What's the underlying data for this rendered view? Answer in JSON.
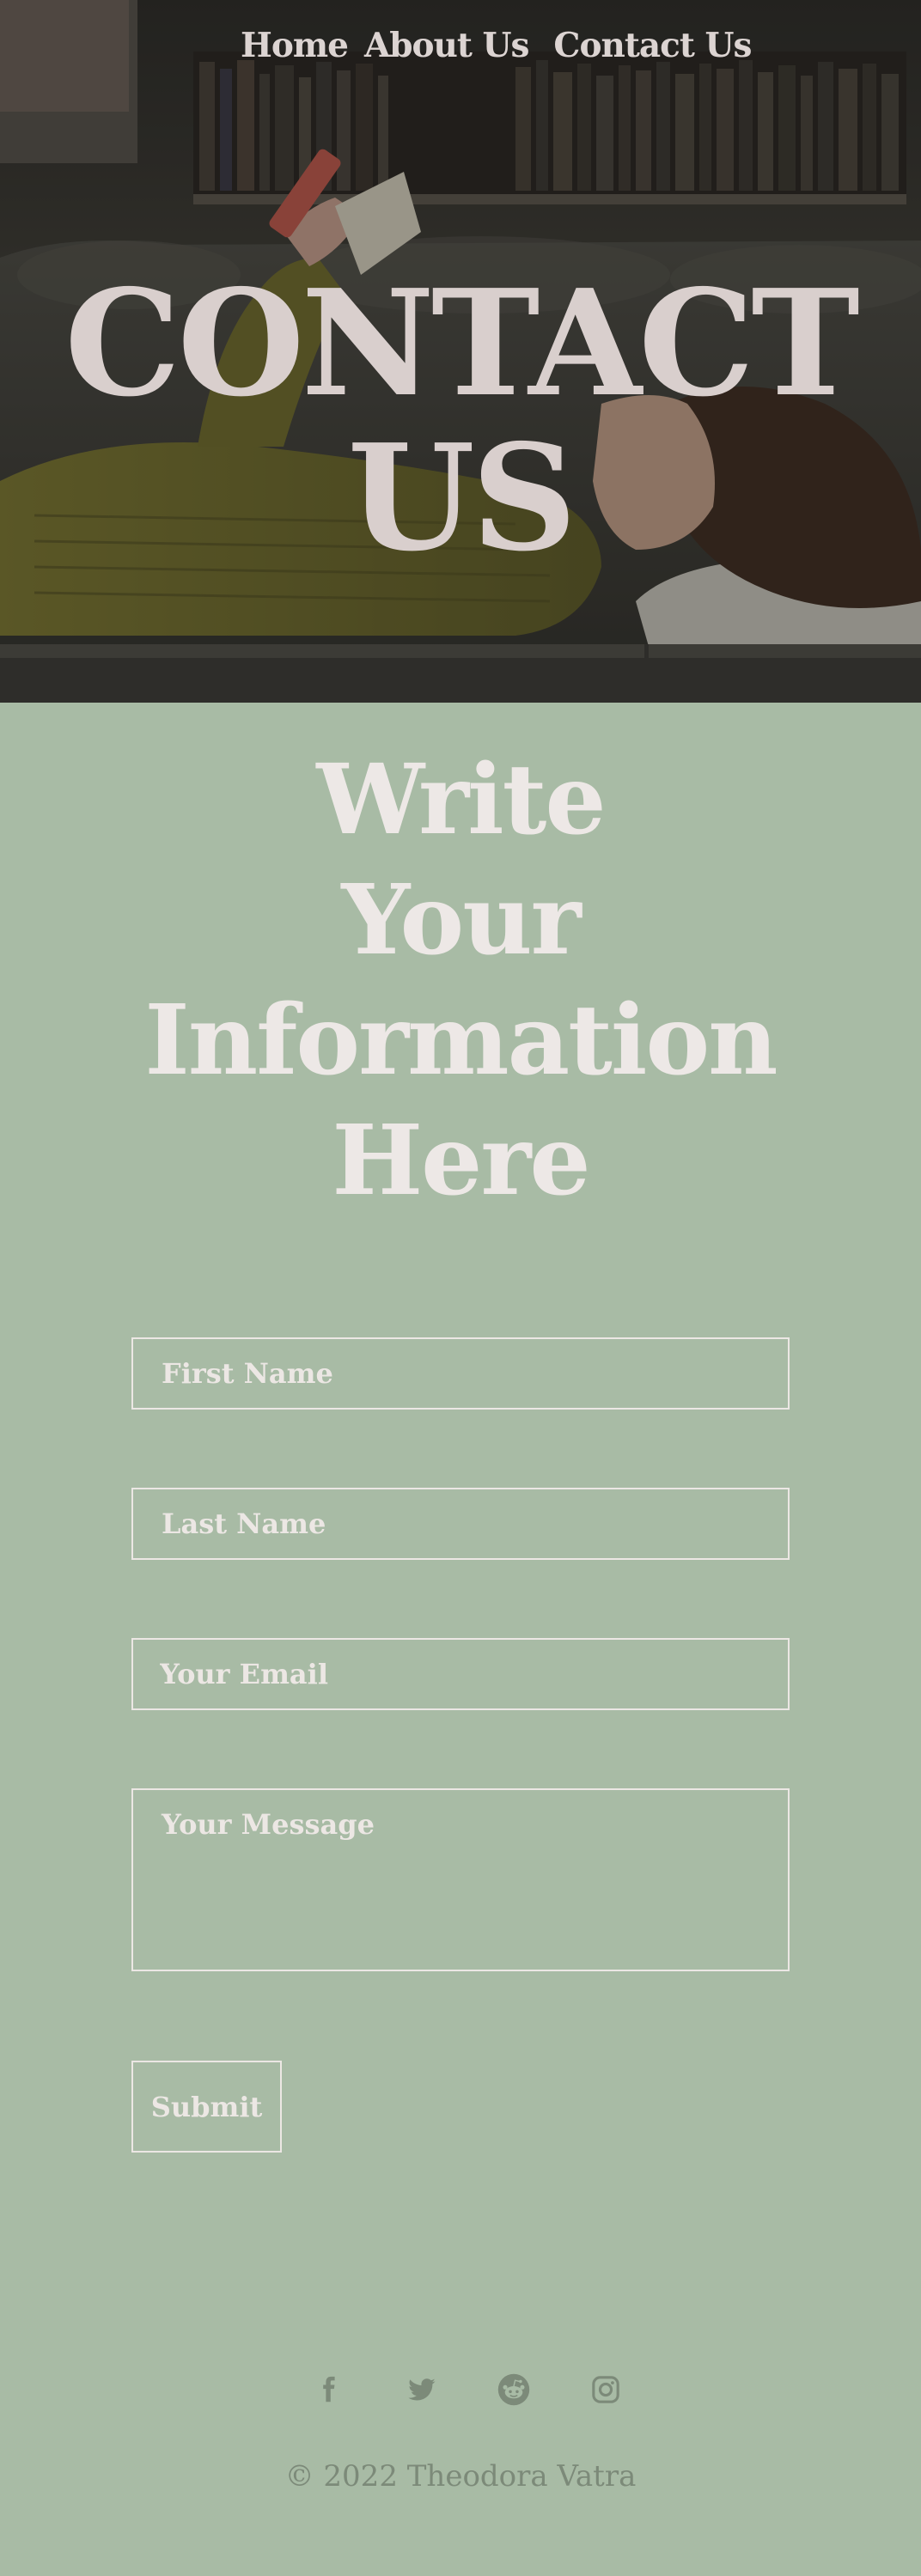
{
  "nav": {
    "items": [
      {
        "label": "Home"
      },
      {
        "label": "About Us"
      },
      {
        "label": "Contact Us"
      }
    ]
  },
  "hero": {
    "title_lines": [
      "CONTACT",
      "US"
    ]
  },
  "form": {
    "heading_lines": [
      "Write",
      "Your",
      "Information",
      "Here"
    ],
    "first_name_placeholder": "First Name",
    "last_name_placeholder": "Last Name",
    "email_placeholder": "Your Email",
    "message_placeholder": "Your Message",
    "submit_label": "Submit"
  },
  "footer": {
    "social_icons": [
      "facebook-icon",
      "twitter-icon",
      "reddit-icon",
      "instagram-icon"
    ],
    "icon_color": "#7c8a79",
    "copyright": "© 2022 Theodora Vatra"
  },
  "colors": {
    "page_background": "#a8bba5",
    "light_text": "#ece7e4",
    "hero_text": "#d9cfcd"
  }
}
